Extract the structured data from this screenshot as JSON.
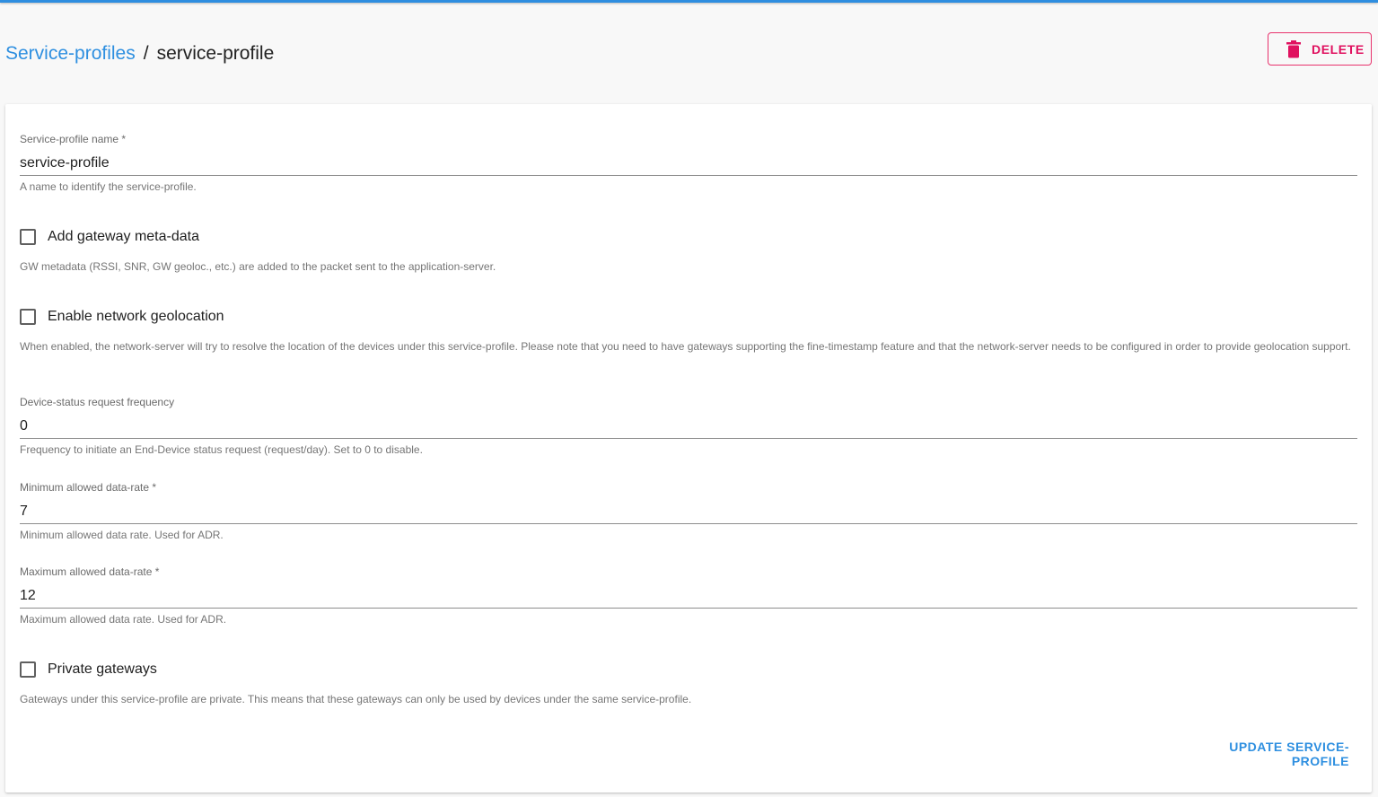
{
  "breadcrumb": {
    "parent": "Service-profiles",
    "separator": "/",
    "current": "service-profile"
  },
  "header": {
    "delete_label": "DELETE",
    "delete_icon": "trash-icon"
  },
  "form": {
    "name": {
      "label": "Service-profile name *",
      "value": "service-profile",
      "helper": "A name to identify the service-profile."
    },
    "add_gw_metadata": {
      "label": "Add gateway meta-data",
      "checked": false,
      "helper": "GW metadata (RSSI, SNR, GW geoloc., etc.) are added to the packet sent to the application-server."
    },
    "network_geolocation": {
      "label": "Enable network geolocation",
      "checked": false,
      "helper": "When enabled, the network-server will try to resolve the location of the devices under this service-profile. Please note that you need to have gateways supporting the fine-timestamp feature and that the network-server needs to be configured in order to provide geolocation support."
    },
    "dev_status_freq": {
      "label": "Device-status request frequency",
      "value": "0",
      "helper": "Frequency to initiate an End-Device status request (request/day). Set to 0 to disable."
    },
    "min_dr": {
      "label": "Minimum allowed data-rate *",
      "value": "7",
      "helper": "Minimum allowed data rate. Used for ADR."
    },
    "max_dr": {
      "label": "Maximum allowed data-rate *",
      "value": "12",
      "helper": "Maximum allowed data rate. Used for ADR."
    },
    "private_gateways": {
      "label": "Private gateways",
      "checked": false,
      "helper": "Gateways under this service-profile are private. This means that these gateways can only be used by devices under the same service-profile."
    },
    "submit_label": "UPDATE SERVICE-PROFILE"
  },
  "colors": {
    "accent": "#2e8fe0",
    "danger": "#e0115f"
  }
}
